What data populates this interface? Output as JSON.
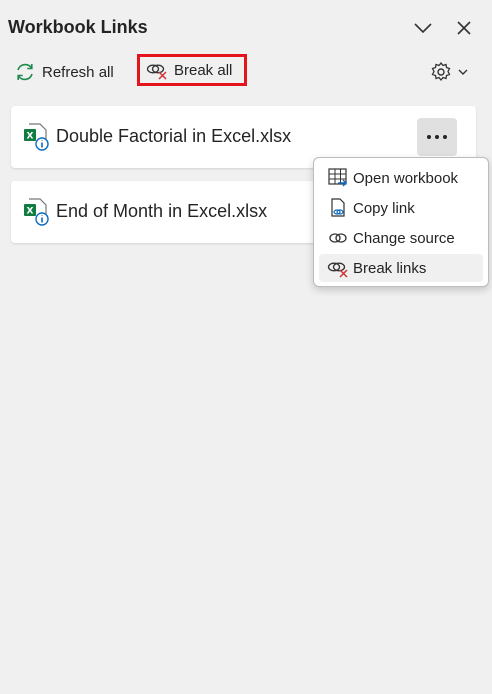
{
  "pane": {
    "title": "Workbook Links"
  },
  "header": {
    "collapse_icon": "chevron-down-icon",
    "close_icon": "close-icon"
  },
  "toolbar": {
    "refresh_label": "Refresh all",
    "break_all_label": "Break all",
    "refresh_icon": "refresh-icon",
    "break_icon": "break-link-icon",
    "settings_icon": "gear-icon"
  },
  "links": [
    {
      "name": "Double Factorial in Excel.xlsx"
    },
    {
      "name": "End of Month in Excel.xlsx"
    }
  ],
  "context_menu": {
    "items": [
      {
        "label": "Open workbook",
        "icon": "open-workbook-icon"
      },
      {
        "label": "Copy link",
        "icon": "copy-link-icon"
      },
      {
        "label": "Change source",
        "icon": "change-source-icon"
      },
      {
        "label": "Break links",
        "icon": "break-link-icon"
      }
    ]
  },
  "colors": {
    "highlight_border": "#e3141b",
    "excel_green": "#107c41",
    "info_blue": "#0f6cbd",
    "accent_red": "#d13438"
  }
}
